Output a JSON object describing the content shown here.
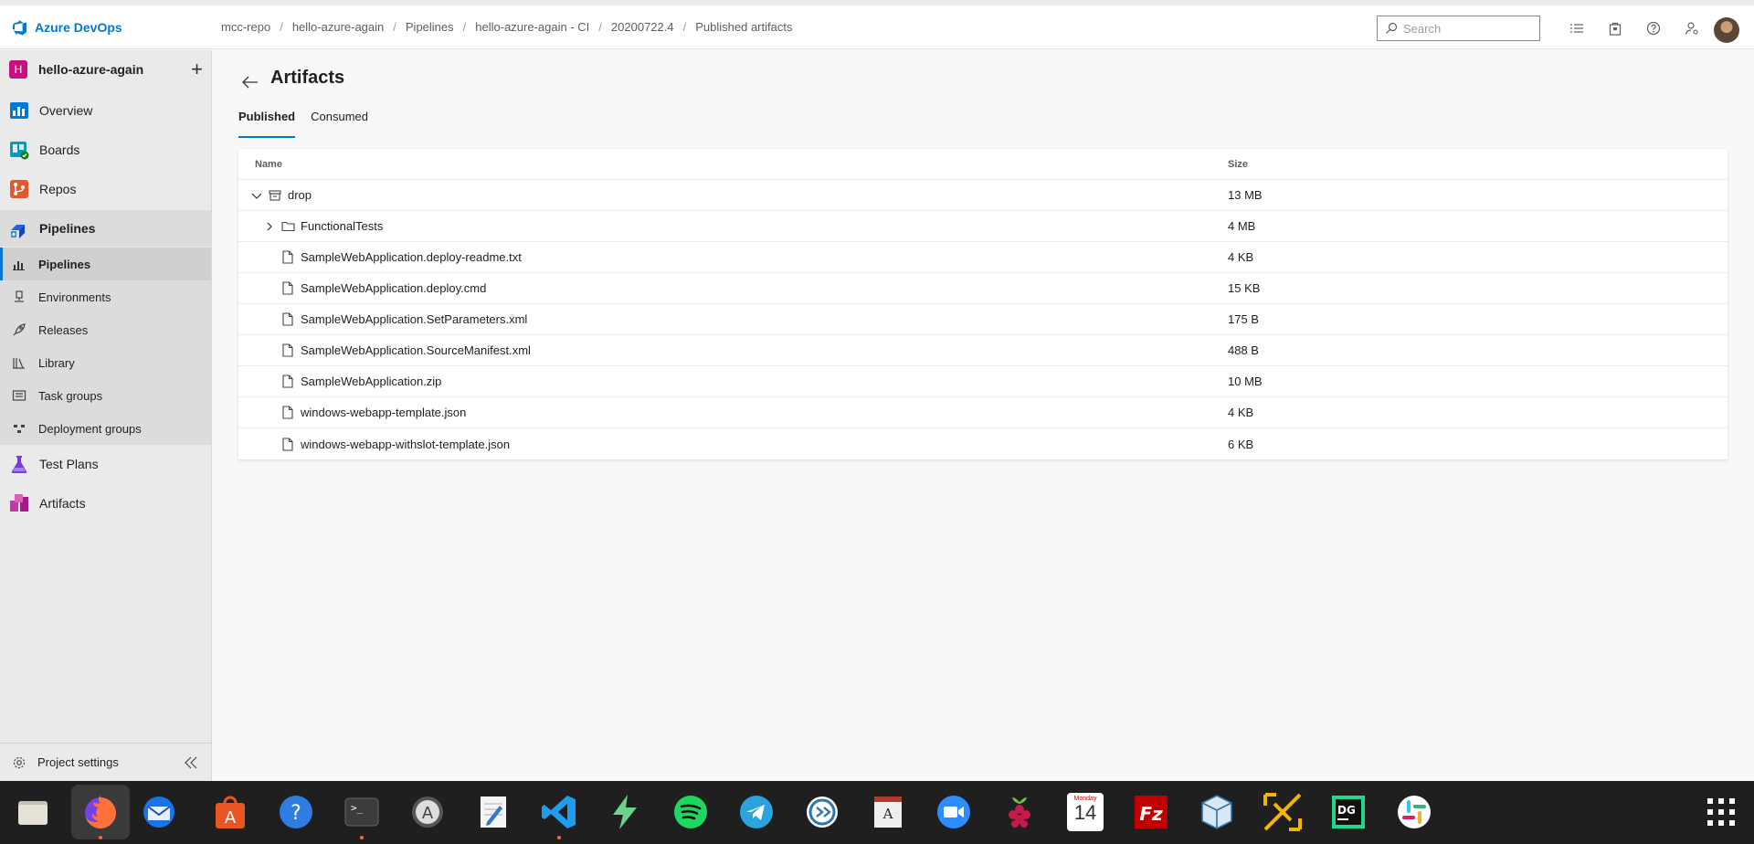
{
  "header": {
    "brand": "Azure DevOps",
    "breadcrumbs": [
      "mcc-repo",
      "hello-azure-again",
      "Pipelines",
      "hello-azure-again - CI",
      "20200722.4",
      "Published artifacts"
    ],
    "search_placeholder": "Search"
  },
  "sidebar": {
    "project_badge": "H",
    "project_name": "hello-azure-again",
    "items": [
      {
        "label": "Overview",
        "icon": "overview-icon"
      },
      {
        "label": "Boards",
        "icon": "boards-icon"
      },
      {
        "label": "Repos",
        "icon": "repos-icon"
      },
      {
        "label": "Pipelines",
        "icon": "pipelines-icon"
      },
      {
        "label": "Test Plans",
        "icon": "test-plans-icon"
      },
      {
        "label": "Artifacts",
        "icon": "artifacts-icon"
      }
    ],
    "sub_items": [
      {
        "label": "Pipelines",
        "icon": "pipelines-sub-icon"
      },
      {
        "label": "Environments",
        "icon": "environments-icon"
      },
      {
        "label": "Releases",
        "icon": "releases-icon"
      },
      {
        "label": "Library",
        "icon": "library-icon"
      },
      {
        "label": "Task groups",
        "icon": "task-groups-icon"
      },
      {
        "label": "Deployment groups",
        "icon": "deployment-groups-icon"
      }
    ],
    "settings_label": "Project settings"
  },
  "main": {
    "title": "Artifacts",
    "tabs": [
      "Published",
      "Consumed"
    ],
    "table": {
      "columns": [
        "Name",
        "Size"
      ],
      "rows": [
        {
          "name": "drop",
          "size": "13 MB",
          "type": "artifact",
          "expanded": true,
          "level": 0
        },
        {
          "name": "FunctionalTests",
          "size": "4 MB",
          "type": "folder",
          "expanded": false,
          "level": 1
        },
        {
          "name": "SampleWebApplication.deploy-readme.txt",
          "size": "4 KB",
          "type": "file",
          "level": 1
        },
        {
          "name": "SampleWebApplication.deploy.cmd",
          "size": "15 KB",
          "type": "file",
          "level": 1
        },
        {
          "name": "SampleWebApplication.SetParameters.xml",
          "size": "175 B",
          "type": "file",
          "level": 1
        },
        {
          "name": "SampleWebApplication.SourceManifest.xml",
          "size": "488 B",
          "type": "file",
          "level": 1
        },
        {
          "name": "SampleWebApplication.zip",
          "size": "10 MB",
          "type": "file",
          "level": 1
        },
        {
          "name": "windows-webapp-template.json",
          "size": "4 KB",
          "type": "file",
          "level": 1
        },
        {
          "name": "windows-webapp-withslot-template.json",
          "size": "6 KB",
          "type": "file",
          "level": 1
        }
      ]
    }
  },
  "dock": {
    "apps": [
      "files-icon",
      "firefox-icon",
      "thunderbird-icon",
      "app-store-icon",
      "help-icon",
      "terminal-icon",
      "software-updater-icon",
      "text-editor-icon",
      "vscode-icon",
      "bolt-icon",
      "spotify-icon",
      "telegram-icon",
      "remmina-icon",
      "dictionary-icon",
      "zoom-icon",
      "raspberry-pi-icon",
      "calendar-icon",
      "filezilla-icon",
      "virtualbox-icon",
      "vnc-icon",
      "datagrip-icon",
      "slack-icon",
      "app-grid-icon"
    ],
    "calendar_day": "Monday",
    "calendar_date": "14"
  }
}
